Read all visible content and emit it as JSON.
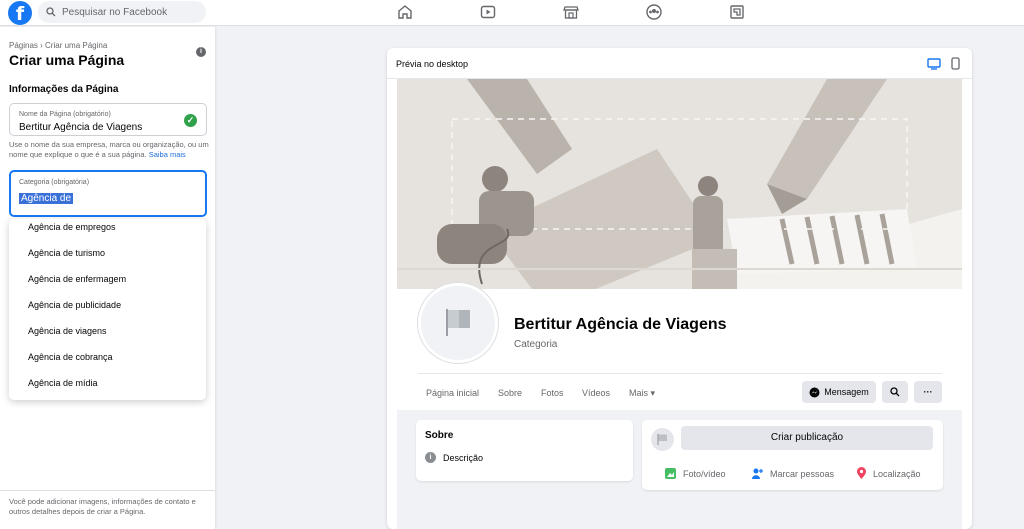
{
  "topbar": {
    "logo": "f",
    "search_placeholder": "Pesquisar no Facebook",
    "nav_icons": [
      "home-icon",
      "watch-icon",
      "marketplace-icon",
      "groups-icon",
      "gaming-icon"
    ]
  },
  "sidebar": {
    "breadcrumb": "Páginas › Criar uma Página",
    "title": "Criar uma Página",
    "section_title": "Informações da Página",
    "name_field": {
      "label": "Nome da Página (obrigatório)",
      "value": "Bertitur Agência de Viagens"
    },
    "helper_text": "Use o nome da sua empresa, marca ou organização, ou um nome que explique o que é a sua página.",
    "helper_link": "Saiba mais",
    "category_field": {
      "label": "Categoria (obrigatória)",
      "value": "Agência de"
    },
    "dropdown_options": [
      "Agência de empregos",
      "Agência de turismo",
      "Agência de enfermagem",
      "Agência de publicidade",
      "Agência de viagens",
      "Agência de cobrança",
      "Agência de mídia"
    ],
    "footer_note": "Você pode adicionar imagens, informações de contato e outros detalhes depois de criar a Página."
  },
  "preview": {
    "title": "Prévia no desktop",
    "page_name": "Bertitur Agência de Viagens",
    "page_category": "Categoria",
    "tabs": [
      "Página inicial",
      "Sobre",
      "Fotos",
      "Vídeos",
      "Mais ▾"
    ],
    "message_button": "Mensagem",
    "about": {
      "title": "Sobre",
      "description": "Descrição"
    },
    "composer": {
      "create_post": "Criar publicação",
      "actions": [
        "Foto/vídeo",
        "Marcar pessoas",
        "Localização"
      ]
    }
  },
  "colors": {
    "brand": "#1877f2",
    "check": "#31a24c",
    "selection": "#3a71d9",
    "background": "#f0f2f5"
  }
}
